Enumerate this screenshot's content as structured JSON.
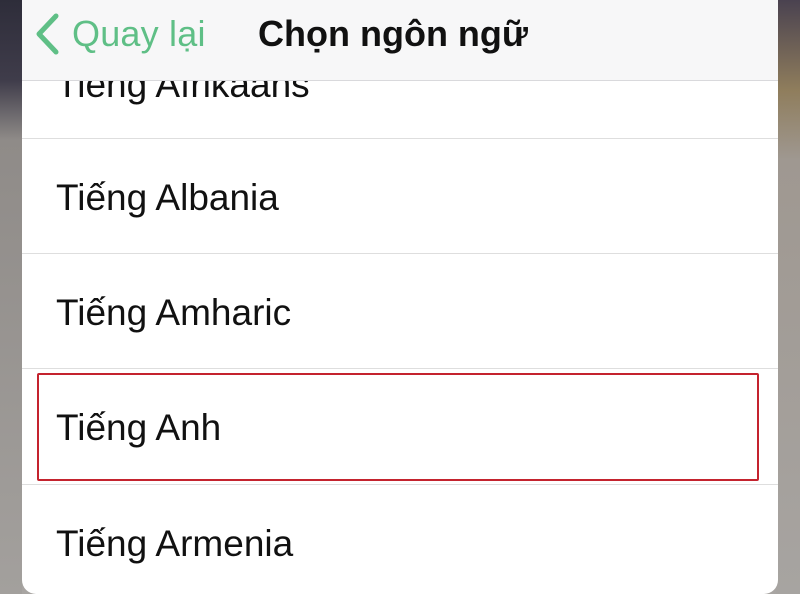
{
  "nav": {
    "back_label": "Quay lại",
    "title": "Chọn ngôn ngữ",
    "accent_color": "#5fbf86"
  },
  "languages": [
    {
      "label": "Tiếng Afrikaans"
    },
    {
      "label": "Tiếng Albania"
    },
    {
      "label": "Tiếng Amharic"
    },
    {
      "label": "Tiếng Anh",
      "highlighted": true
    },
    {
      "label": "Tiếng Armenia"
    }
  ],
  "highlight_color": "#c4232e"
}
